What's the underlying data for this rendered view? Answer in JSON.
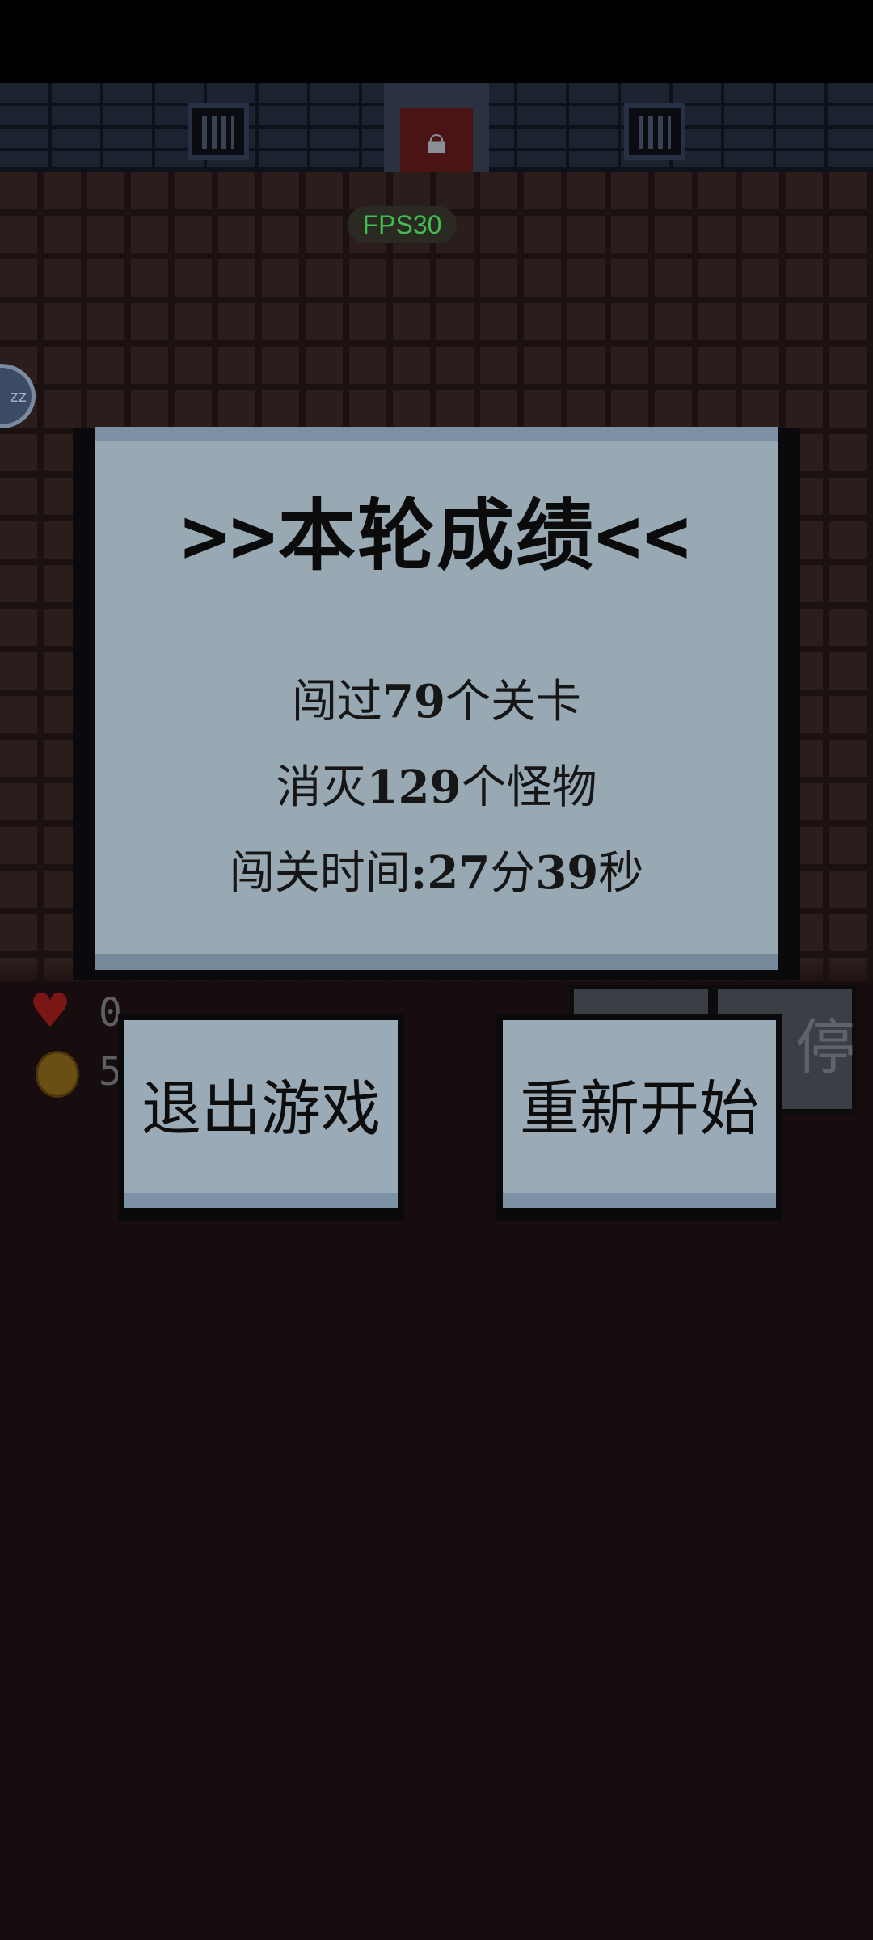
{
  "hud": {
    "fps_label": "FPS30",
    "hp_value": "0",
    "gold_value": "5",
    "pause_label": "停",
    "sleep_label": "zz"
  },
  "dialog": {
    "title": ">>本轮成绩<<",
    "levels": {
      "prefix": "闯过",
      "value": "79",
      "suffix": "个关卡"
    },
    "kills": {
      "prefix": "消灭",
      "value": "129",
      "suffix": "个怪物"
    },
    "time": {
      "prefix": "闯关时间",
      "separator": ":",
      "minutes": "27",
      "min_unit": "分",
      "seconds": "39",
      "sec_unit": "秒"
    }
  },
  "buttons": {
    "exit_label": "退出游戏",
    "restart_label": "重新开始"
  },
  "colors": {
    "dialog_bg": "#98a9b4",
    "fps_green": "#3fbf4e",
    "heart_red": "#7a1616"
  }
}
